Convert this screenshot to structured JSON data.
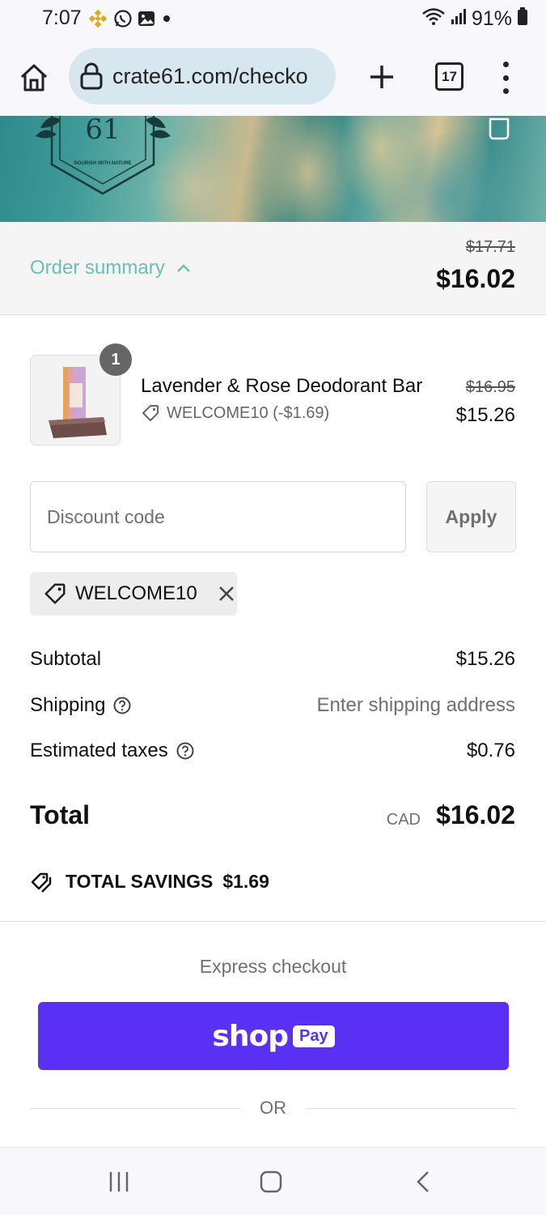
{
  "status_bar": {
    "time": "7:07",
    "battery": "91%",
    "left_icons": [
      "binance-icon",
      "whatsapp-icon",
      "gallery-icon",
      "dot-icon"
    ],
    "right_icons": [
      "wifi-icon",
      "signal-icon",
      "battery-icon"
    ]
  },
  "browser": {
    "url": "crate61.com/checko",
    "tab_count": "17",
    "icons": [
      "home-icon",
      "lock-icon",
      "plus-icon",
      "tabs-icon",
      "more-vert-icon"
    ]
  },
  "hero": {
    "logo_text": "61",
    "logo_tagline": "NOURISH WITH NATURE",
    "icons": [
      "cart-bag-icon"
    ]
  },
  "order_summary": {
    "label": "Order summary",
    "original_total": "$17.71",
    "total": "$16.02"
  },
  "product": {
    "quantity": "1",
    "name": "Lavender & Rose Deodorant Bar",
    "discount": "WELCOME10 (-$1.69)",
    "original_price": "$16.95",
    "price": "$15.26"
  },
  "discount": {
    "placeholder": "Discount code",
    "apply_label": "Apply",
    "applied_code": "WELCOME10"
  },
  "totals": {
    "subtotal_label": "Subtotal",
    "subtotal_value": "$15.26",
    "shipping_label": "Shipping",
    "shipping_value": "Enter shipping address",
    "taxes_label": "Estimated taxes",
    "taxes_value": "$0.76",
    "total_label": "Total",
    "currency": "CAD",
    "total_value": "$16.02",
    "savings_label": "TOTAL SAVINGS",
    "savings_value": "$1.69"
  },
  "express": {
    "label": "Express checkout",
    "shop_text": "shop",
    "pay_text": "Pay",
    "or_text": "OR"
  },
  "colors": {
    "accent_teal": "#6cbfb3",
    "shop_pay_purple": "#5a31f4"
  }
}
